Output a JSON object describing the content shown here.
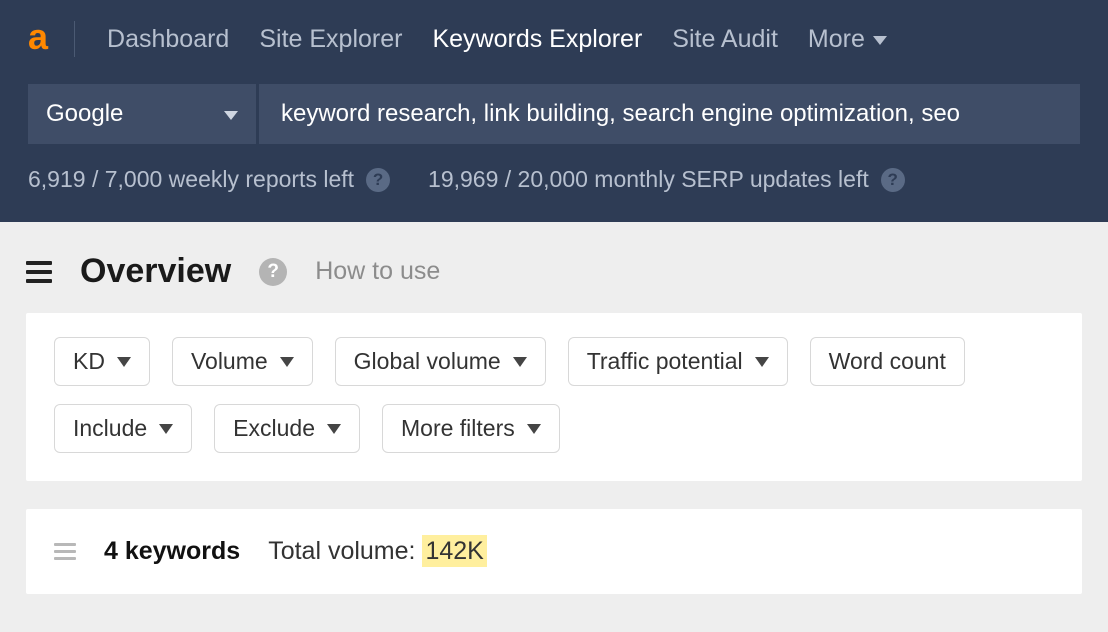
{
  "nav": {
    "dashboard": "Dashboard",
    "site_explorer": "Site Explorer",
    "keywords_explorer": "Keywords Explorer",
    "site_audit": "Site Audit",
    "more": "More"
  },
  "search_engine": "Google",
  "keyword_input": "keyword research, link building, search engine optimization, seo",
  "usage": {
    "reports": "6,919 / 7,000 weekly reports left",
    "serp": "19,969 / 20,000 monthly SERP updates left"
  },
  "overview": {
    "title": "Overview",
    "how_to": "How to use"
  },
  "filters": {
    "kd": "KD",
    "volume": "Volume",
    "global_volume": "Global volume",
    "traffic_potential": "Traffic potential",
    "word_count": "Word count",
    "include": "Include",
    "exclude": "Exclude",
    "more_filters": "More filters"
  },
  "results": {
    "count_label": "4 keywords",
    "total_volume_label": "Total volume: ",
    "total_volume_value": "142K"
  }
}
